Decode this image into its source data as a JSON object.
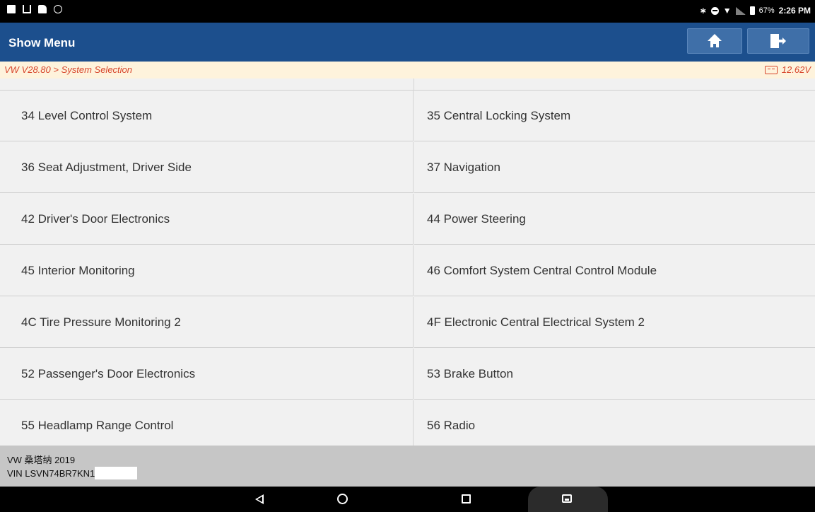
{
  "status_bar": {
    "battery_pct": "67%",
    "time": "2:26 PM"
  },
  "header": {
    "title": "Show Menu",
    "home_icon": "home-icon",
    "exit_icon": "exit-icon"
  },
  "breadcrumb": {
    "path": "VW V28.80 > System Selection",
    "voltage": "12.62V"
  },
  "systems": {
    "rows": [
      {
        "left": "34 Level Control System",
        "right": "35 Central Locking System"
      },
      {
        "left": "36 Seat Adjustment, Driver Side",
        "right": "37 Navigation"
      },
      {
        "left": "42 Driver's Door Electronics",
        "right": "44 Power Steering"
      },
      {
        "left": "45 Interior Monitoring",
        "right": "46 Comfort System Central Control Module"
      },
      {
        "left": "4C Tire Pressure Monitoring 2",
        "right": "4F Electronic Central Electrical System 2"
      },
      {
        "left": "52 Passenger's Door Electronics",
        "right": "53 Brake Button"
      },
      {
        "left": "55 Headlamp Range Control",
        "right": "56 Radio"
      }
    ]
  },
  "footer": {
    "model": "VW 桑塔纳 2019",
    "vin": "VIN LSVN74BR7KN1"
  },
  "colors": {
    "title_bar": "#1c4f8d",
    "breadcrumb_bg": "#fef3dc",
    "breadcrumb_text": "#d7462c",
    "list_bg": "#f1f1f1",
    "footer_bg": "#c6c6c6"
  }
}
